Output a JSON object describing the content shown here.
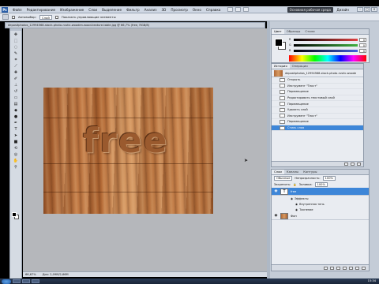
{
  "menubar": {
    "logo": "Ps",
    "items": [
      "Файл",
      "Редактирование",
      "Изображение",
      "Слои",
      "Выделение",
      "Фильтр",
      "Анализ",
      "3D",
      "Просмотр",
      "Окно",
      "Справка"
    ],
    "workspace_label": "Основная рабочая среда",
    "workspace_switch": "Дизайн"
  },
  "options": {
    "sample_label": "Автовыбор:",
    "sample_value": "Слой",
    "show_transform": "Показать управляющие элементы"
  },
  "document": {
    "tab_title": "depositphotos_12994568-stock-photo-rustic-wooden-wood-texture-table.jpg @ 66,7% (free, RGB/8)"
  },
  "canvas": {
    "carved_text": "free"
  },
  "status": {
    "zoom": "66,67%",
    "doc_size": "Док: 2,09M/2,66M"
  },
  "color_panel": {
    "tabs": [
      "Цвет",
      "Образцы",
      "Стили"
    ],
    "channels": [
      {
        "name": "R",
        "value": "0",
        "color": "#e04040"
      },
      {
        "name": "G",
        "value": "0",
        "color": "#40b040"
      },
      {
        "name": "B",
        "value": "0",
        "color": "#4060e0"
      }
    ]
  },
  "history_panel": {
    "tabs": [
      "История",
      "Операции"
    ],
    "snapshot": "depositphotos_12994568-stock-photo-rustic-wooden-wood-texture-table.jpg",
    "entries": [
      "Открыть",
      "Инструмент \"Текст\"",
      "Перемещение",
      "Редактировать текстовый слой",
      "Перемещение",
      "Удалить слой",
      "Инструмент \"Текст\"",
      "Перемещение",
      "Стиль слоя"
    ],
    "selected_index": 8
  },
  "layers_panel": {
    "tabs": [
      "Слои",
      "Каналы",
      "Контуры"
    ],
    "blend_mode": "Обычные",
    "opacity_label": "Непрозрачность:",
    "opacity_value": "100%",
    "lock_label": "Закрепить:",
    "fill_label": "Заливка:",
    "fill_value": "100%",
    "layers": [
      {
        "name": "free",
        "type": "T",
        "selected": true
      },
      {
        "name": "Фон",
        "type": "img",
        "selected": false
      }
    ],
    "effects_label": "Эффекты",
    "effects": [
      "Внутренняя тень",
      "Тиснение"
    ]
  },
  "taskbar": {
    "clock": "15:34"
  }
}
